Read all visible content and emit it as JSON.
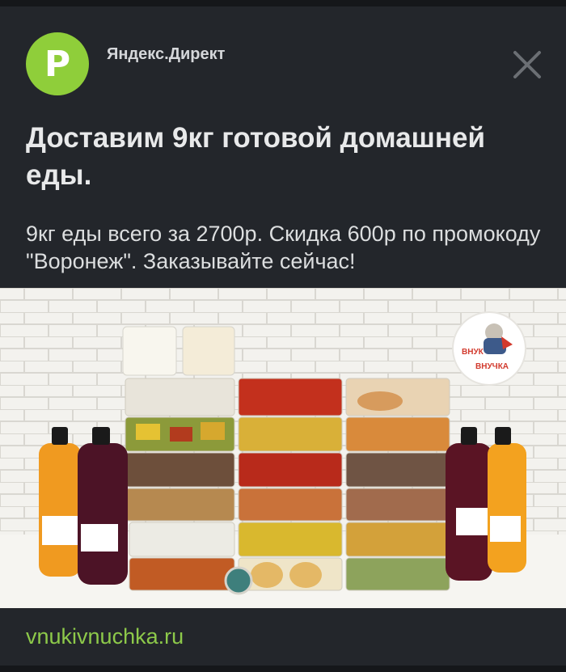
{
  "ad": {
    "avatar_letter": "P",
    "source": "Яндекс.Директ",
    "headline": "Доставим 9кг готовой домашней еды.",
    "body": "9кг еды всего за 2700р. Скидка 600р по промокоду \"Воронеж\". Заказывайте сейчас!",
    "domain": "vnukivnuchka.ru",
    "logo_text_top": "ВНУК",
    "logo_text_bottom": "ВНУЧКА",
    "close_icon": "close-x-icon"
  },
  "colors": {
    "avatar": "#8fce3a",
    "link": "#8dc94a",
    "background": "#23262b"
  }
}
